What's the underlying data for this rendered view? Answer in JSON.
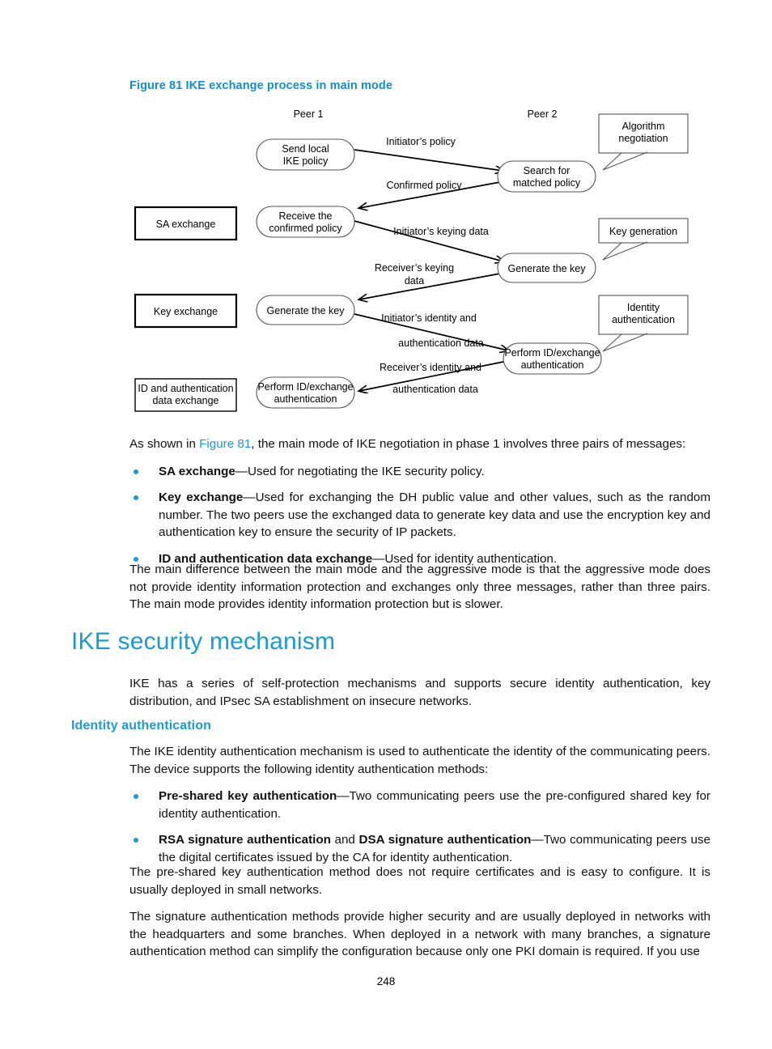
{
  "figure": {
    "caption": "Figure 81 IKE exchange process in main mode",
    "peer1_label": "Peer 1",
    "peer2_label": "Peer 2",
    "stage_boxes": [
      {
        "id": "sa-exchange",
        "text": "SA exchange"
      },
      {
        "id": "key-exchange",
        "text": "Key exchange"
      },
      {
        "id": "id-auth-exchange",
        "line1": "ID and authentication",
        "line2": "data exchange"
      }
    ],
    "peer1_nodes": [
      {
        "id": "send-local-ike-policy",
        "line1": "Send local",
        "line2": "IKE policy"
      },
      {
        "id": "receive-confirmed-policy",
        "line1": "Receive the",
        "line2": "confirmed policy"
      },
      {
        "id": "generate-the-key-peer1",
        "line1": "Generate the key",
        "line2": ""
      },
      {
        "id": "perform-id-exchange-auth-peer1",
        "line1": "Perform ID/exchange",
        "line2": "authentication"
      }
    ],
    "peer2_nodes": [
      {
        "id": "search-for-matched-policy",
        "line1": "Search for",
        "line2": "matched policy"
      },
      {
        "id": "generate-the-key-peer2",
        "line1": "Generate the key",
        "line2": ""
      },
      {
        "id": "perform-id-exchange-auth-peer2",
        "line1": "Perform ID/exchange",
        "line2": "authentication"
      }
    ],
    "callouts": [
      {
        "id": "algorithm-negotiation",
        "line1": "Algorithm",
        "line2": "negotiation"
      },
      {
        "id": "key-generation",
        "line1": "Key generation",
        "line2": ""
      },
      {
        "id": "identity-authentication",
        "line1": "Identity",
        "line2": "authentication"
      }
    ],
    "arrow_labels": [
      {
        "id": "initiators-policy",
        "line1": "Initiator’s policy",
        "line2": ""
      },
      {
        "id": "confirmed-policy",
        "line1": "Confirmed policy",
        "line2": ""
      },
      {
        "id": "initiators-keying-data",
        "line1": "Initiator’s keying data",
        "line2": ""
      },
      {
        "id": "receivers-keying-data",
        "line1": "Receiver’s keying",
        "line2": "data"
      },
      {
        "id": "initiators-identity-and-auth-data",
        "line1": "Initiator’s identity and",
        "line2": "authentication data"
      },
      {
        "id": "receivers-identity-and-auth-data",
        "line1": "Receiver’s identity and",
        "line2": "authentication data"
      }
    ]
  },
  "body": {
    "intro_before_xref": "As shown in ",
    "intro_xref": "Figure 81",
    "intro_after_xref": ", the main mode of IKE negotiation in phase 1 involves three pairs of messages:",
    "bullets": [
      {
        "term": "SA exchange",
        "rest": "—Used for negotiating the IKE security policy."
      },
      {
        "term": "Key exchange",
        "rest": "—Used for exchanging the DH public value and other values, such as the random number. The two peers use the exchanged data to generate key data and use the encryption key and authentication key to ensure the security of IP packets."
      },
      {
        "term": "ID and authentication data exchange",
        "rest": "—Used for identity authentication."
      }
    ],
    "para_difference": "The main difference between the main mode and the aggressive mode is that the aggressive mode does not provide identity information protection and exchanges only three messages, rather than three pairs. The main mode provides identity information protection but is slower."
  },
  "headings": {
    "h1": "IKE security mechanism",
    "h2": "Identity authentication"
  },
  "section": {
    "intro": "IKE has a series of self-protection mechanisms and supports secure identity authentication, key distribution, and IPsec SA establishment on insecure networks.",
    "identity_intro": "The IKE identity authentication mechanism is used to authenticate the identity of the communicating peers. The device supports the following identity authentication methods:",
    "auth_bullets": [
      {
        "term": "Pre-shared key authentication",
        "mid": "",
        "term2": "",
        "rest": "—Two communicating peers use the pre-configured shared key for identity authentication."
      },
      {
        "term": "RSA signature authentication",
        "mid": " and ",
        "term2": "DSA signature authentication",
        "rest": "—Two communicating peers use the digital certificates issued by the CA for identity authentication."
      }
    ],
    "para_preshared": "The pre-shared key authentication method does not require certificates and is easy to configure. It is usually deployed in small networks.",
    "para_signature": "The signature authentication methods provide higher security and are usually deployed in networks with the headquarters and some branches. When deployed in a network with many branches, a signature authentication method can simplify the configuration because only one PKI domain is required. If you use"
  },
  "footer": {
    "page_number": "248"
  },
  "colors": {
    "accent_blue": "#1a9ad7",
    "caption_blue": "#0f8fd0",
    "text_black": "#111111"
  }
}
